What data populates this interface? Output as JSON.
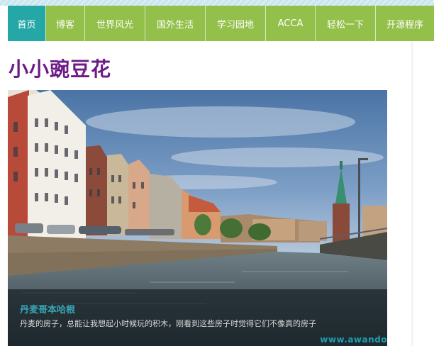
{
  "nav": {
    "items": [
      {
        "label": "首页",
        "active": true
      },
      {
        "label": "博客",
        "active": false
      },
      {
        "label": "世界风光",
        "active": false
      },
      {
        "label": "国外生活",
        "active": false
      },
      {
        "label": "学习园地",
        "active": false
      },
      {
        "label": "ACCA",
        "active": false
      },
      {
        "label": "轻松一下",
        "active": false
      },
      {
        "label": "开源程序",
        "active": false
      }
    ]
  },
  "site": {
    "title": "小小豌豆花"
  },
  "slide": {
    "title": "丹麦哥本哈根",
    "description": "丹麦的房子，总能让我想起小时候玩的积木，刚看到这些房子时觉得它们不像真的房子",
    "watermark": "www.awando"
  },
  "colors": {
    "nav_bg": "#93c04a",
    "nav_active": "#24a7a6",
    "title_color": "#6d1b87",
    "caption_title": "#37a7b6"
  }
}
